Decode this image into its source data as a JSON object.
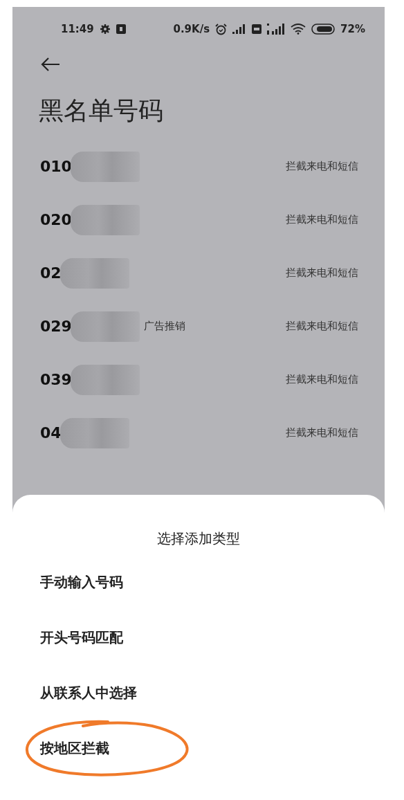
{
  "status_bar": {
    "time": "11:49",
    "speed": "0.9K/s",
    "battery": "72%"
  },
  "title": "黑名单号码",
  "numbers": [
    {
      "number": "010",
      "action": "拦截来电和短信"
    },
    {
      "number": "020",
      "action": "拦截来电和短信"
    },
    {
      "number": "02",
      "action": "拦截来电和短信"
    },
    {
      "number": "029",
      "tag": "广告推销",
      "action": "拦截来电和短信"
    },
    {
      "number": "039",
      "action": "拦截来电和短信"
    },
    {
      "number": "04",
      "action": "拦截来电和短信"
    }
  ],
  "sheet": {
    "title": "选择添加类型",
    "options": [
      {
        "label": "手动输入号码",
        "highlighted": false
      },
      {
        "label": "开头号码匹配",
        "highlighted": false
      },
      {
        "label": "从联系人中选择",
        "highlighted": false
      },
      {
        "label": "按地区拦截",
        "highlighted": true
      }
    ]
  }
}
